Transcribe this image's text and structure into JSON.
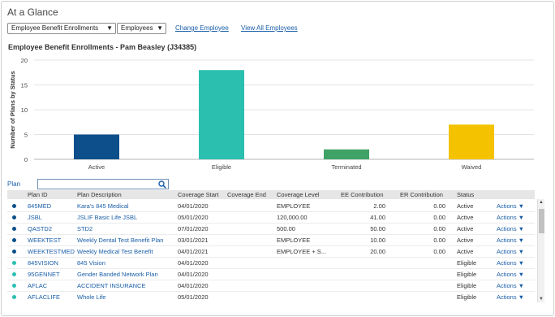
{
  "app": {
    "title": "At a Glance"
  },
  "filters": {
    "category_select": "Employee Benefit Enrollments",
    "population_select": "Employees",
    "change_employee": "Change Employee",
    "view_all": "View All Employees"
  },
  "chart_title": "Employee Benefit Enrollments - Pam Beasley (J34385)",
  "chart_data": {
    "type": "bar",
    "categories": [
      "Active",
      "Eligible",
      "Terminated",
      "Waived"
    ],
    "values": [
      5,
      18,
      2,
      7
    ],
    "colors": [
      "#0c4f8a",
      "#2bbfb0",
      "#3fa266",
      "#f5c200"
    ],
    "xlabel": "",
    "ylabel": "Number of Plans by Status",
    "ylim": [
      0,
      20
    ],
    "yticks": [
      0,
      5,
      10,
      15,
      20
    ],
    "grid": true
  },
  "plan_filter": {
    "label": "Plan",
    "placeholder": ""
  },
  "table": {
    "headers": [
      "Plan ID",
      "Plan Description",
      "Coverage Start",
      "Coverage End",
      "Coverage Level",
      "EE Contribution",
      "ER Contribution",
      "Status"
    ],
    "rows": [
      {
        "dot": "#0c4f8a",
        "id": "845MED",
        "desc": "Kara's 845 Medical",
        "start": "04/01/2020",
        "end": "",
        "level": "EMPLOYEE",
        "ee": "2.00",
        "er": "0.00",
        "status": "Active",
        "actions": "Actions ▼"
      },
      {
        "dot": "#0c4f8a",
        "id": "JSBL",
        "desc": "JSLIF Basic Life JSBL",
        "start": "05/01/2020",
        "end": "",
        "level": "120,000.00",
        "ee": "41.00",
        "er": "0.00",
        "status": "Active",
        "actions": "Actions ▼"
      },
      {
        "dot": "#0c4f8a",
        "id": "QASTD2",
        "desc": "STD2",
        "start": "07/01/2020",
        "end": "",
        "level": "500.00",
        "ee": "50.00",
        "er": "0.00",
        "status": "Active",
        "actions": "Actions ▼"
      },
      {
        "dot": "#0c4f8a",
        "id": "WEEKTEST",
        "desc": "Weekly Dental Test Benefit Plan",
        "start": "03/01/2021",
        "end": "",
        "level": "EMPLOYEE",
        "ee": "10.00",
        "er": "0.00",
        "status": "Active",
        "actions": "Actions ▼"
      },
      {
        "dot": "#0c4f8a",
        "id": "WEEKTESTMED",
        "desc": "Weekly Medical Test Benefit",
        "start": "04/01/2021",
        "end": "",
        "level": "EMPLOYEE + S...",
        "ee": "20.00",
        "er": "0.00",
        "status": "Active",
        "actions": "Actions ▼"
      },
      {
        "dot": "#2bbfb0",
        "id": "845VISION",
        "desc": "845 Vision",
        "start": "04/01/2020",
        "end": "",
        "level": "",
        "ee": "",
        "er": "",
        "status": "Eligible",
        "actions": "Actions ▼"
      },
      {
        "dot": "#2bbfb0",
        "id": "95GENNET",
        "desc": "Gender Banded Network Plan",
        "start": "04/01/2020",
        "end": "",
        "level": "",
        "ee": "",
        "er": "",
        "status": "Eligible",
        "actions": "Actions ▼"
      },
      {
        "dot": "#2bbfb0",
        "id": "AFLAC",
        "desc": "ACCIDENT INSURANCE",
        "start": "04/01/2020",
        "end": "",
        "level": "",
        "ee": "",
        "er": "",
        "status": "Eligible",
        "actions": "Actions ▼"
      },
      {
        "dot": "#2bbfb0",
        "id": "AFLACLIFE",
        "desc": "Whole Life",
        "start": "05/01/2020",
        "end": "",
        "level": "",
        "ee": "",
        "er": "",
        "status": "Eligible",
        "actions": "Actions ▼"
      }
    ]
  }
}
